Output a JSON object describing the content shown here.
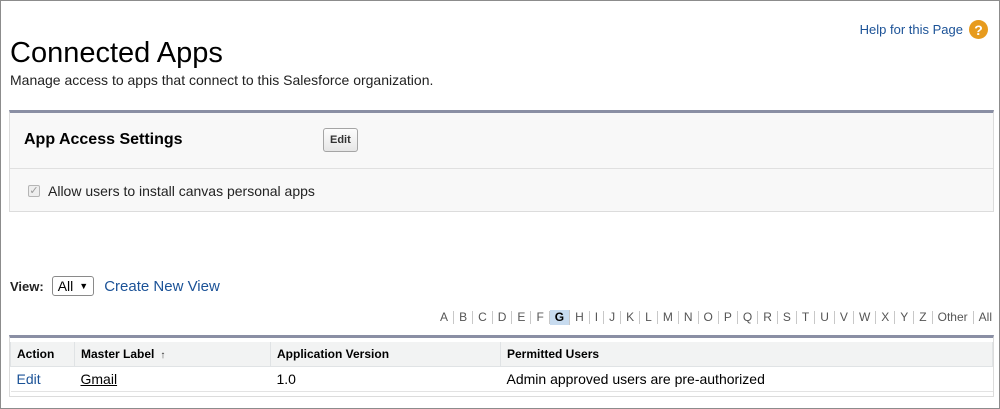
{
  "header": {
    "title": "Connected Apps",
    "help_link": "Help for this Page",
    "help_icon": "?"
  },
  "subtitle": "Manage access to apps that connect to this Salesforce organization.",
  "settings": {
    "title": "App Access Settings",
    "edit_label": "Edit",
    "checkbox_label": "Allow users to install canvas personal apps",
    "checkbox_checked": true
  },
  "view": {
    "label": "View:",
    "selected": "All",
    "create_link": "Create New View"
  },
  "alphabet": [
    "A",
    "B",
    "C",
    "D",
    "E",
    "F",
    "G",
    "H",
    "I",
    "J",
    "K",
    "L",
    "M",
    "N",
    "O",
    "P",
    "Q",
    "R",
    "S",
    "T",
    "U",
    "V",
    "W",
    "X",
    "Y",
    "Z",
    "Other",
    "All"
  ],
  "alphabet_active": "G",
  "table": {
    "headers": [
      "Action",
      "Master Label",
      "Application Version",
      "Permitted Users"
    ],
    "sort_indicator": "↑",
    "rows": [
      {
        "action": "Edit",
        "label": "Gmail",
        "version": "1.0",
        "permitted": "Admin approved users are pre-authorized"
      }
    ]
  },
  "colors": {
    "link": "#1b5297",
    "help_icon": "#e79b1e",
    "panel_border": "#8a8fa4",
    "active_letter_bg": "#c7dbef"
  }
}
